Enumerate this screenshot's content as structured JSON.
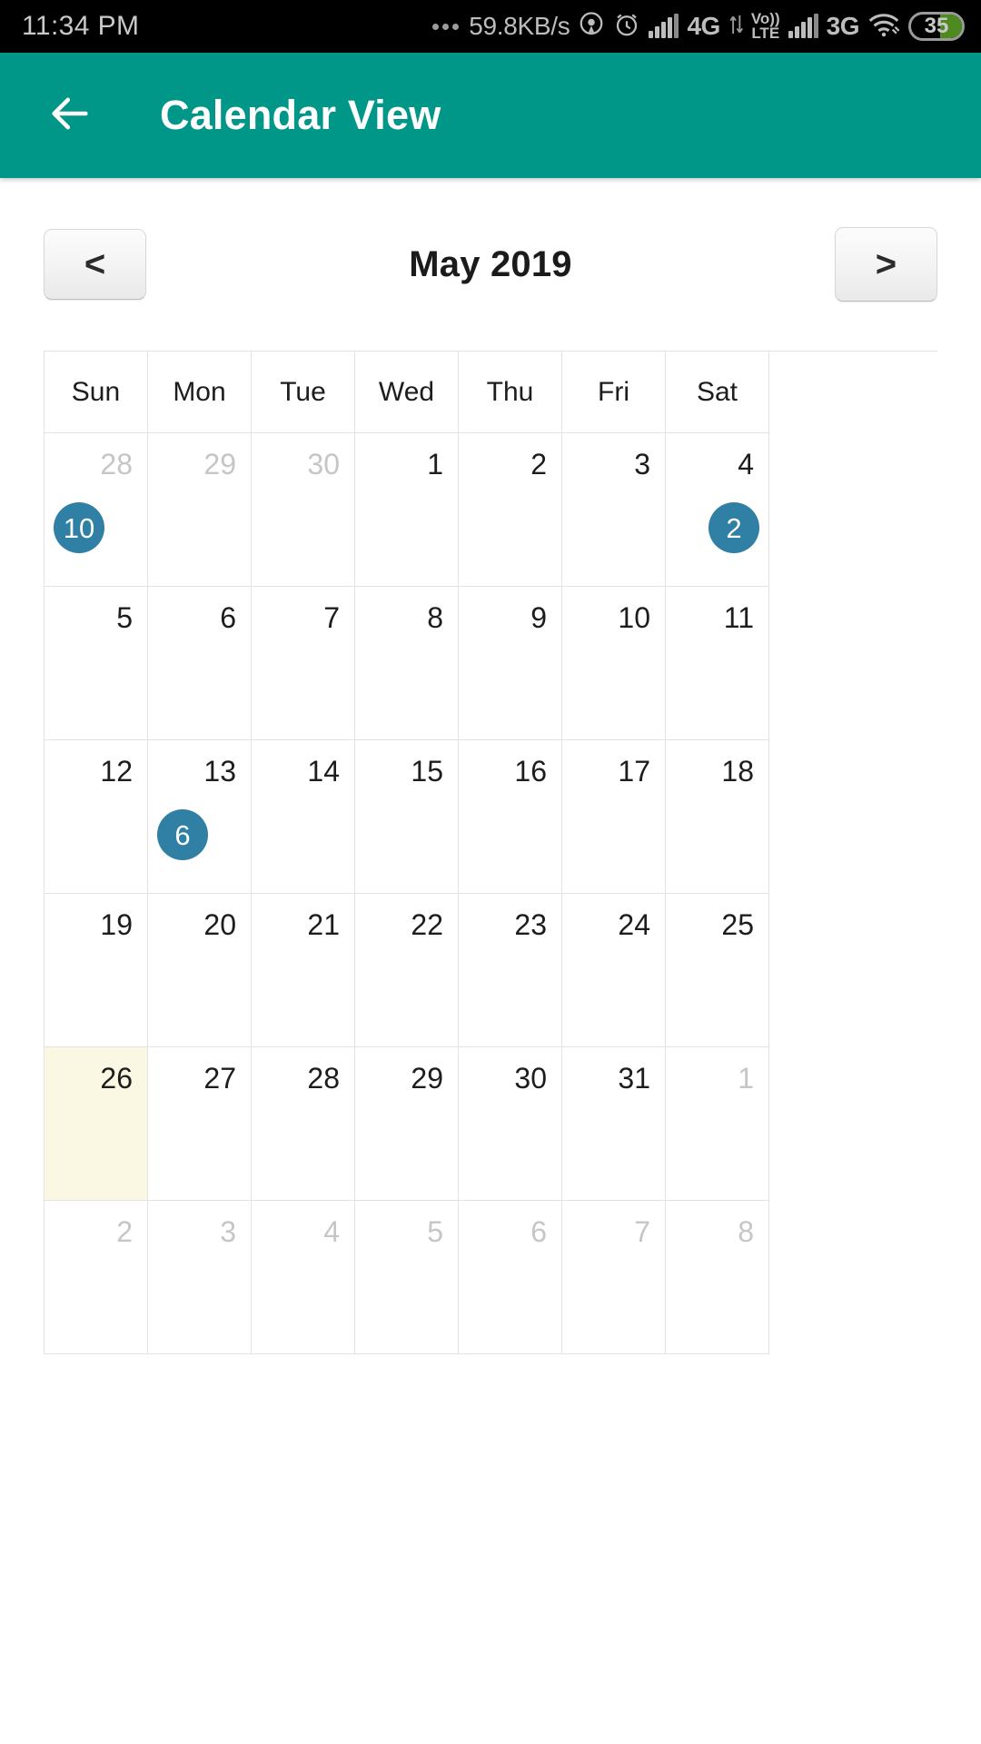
{
  "status_bar": {
    "time": "11:34 PM",
    "network_speed": "59.8KB/s",
    "network_1": "4G",
    "volte_top": "Vo))",
    "volte_bottom": "LTE",
    "network_2": "3G",
    "battery_level": "35",
    "icons": [
      "location-icon",
      "alarm-icon",
      "signal-bars-icon",
      "volte-icon",
      "wifi-icon",
      "battery-icon"
    ]
  },
  "app_bar": {
    "back_icon": "arrow-left-icon",
    "title": "Calendar View",
    "color": "#009688"
  },
  "month_nav": {
    "prev_label": "<",
    "next_label": ">",
    "month_title": "May 2019"
  },
  "calendar": {
    "weekday_headers": [
      "Sun",
      "Mon",
      "Tue",
      "Wed",
      "Thu",
      "Fri",
      "Sat"
    ],
    "today_color": "#faf7e2",
    "badge_color": "#2f80a4",
    "weeks": [
      [
        {
          "day": "28",
          "muted": true,
          "today": false,
          "badge": "10",
          "badge_side": "left"
        },
        {
          "day": "29",
          "muted": true,
          "today": false,
          "badge": null,
          "badge_side": null
        },
        {
          "day": "30",
          "muted": true,
          "today": false,
          "badge": null,
          "badge_side": null
        },
        {
          "day": "1",
          "muted": false,
          "today": false,
          "badge": null,
          "badge_side": null
        },
        {
          "day": "2",
          "muted": false,
          "today": false,
          "badge": null,
          "badge_side": null
        },
        {
          "day": "3",
          "muted": false,
          "today": false,
          "badge": null,
          "badge_side": null
        },
        {
          "day": "4",
          "muted": false,
          "today": false,
          "badge": "2",
          "badge_side": "right"
        }
      ],
      [
        {
          "day": "5",
          "muted": false,
          "today": false,
          "badge": null,
          "badge_side": null
        },
        {
          "day": "6",
          "muted": false,
          "today": false,
          "badge": null,
          "badge_side": null
        },
        {
          "day": "7",
          "muted": false,
          "today": false,
          "badge": null,
          "badge_side": null
        },
        {
          "day": "8",
          "muted": false,
          "today": false,
          "badge": null,
          "badge_side": null
        },
        {
          "day": "9",
          "muted": false,
          "today": false,
          "badge": null,
          "badge_side": null
        },
        {
          "day": "10",
          "muted": false,
          "today": false,
          "badge": null,
          "badge_side": null
        },
        {
          "day": "11",
          "muted": false,
          "today": false,
          "badge": null,
          "badge_side": null
        }
      ],
      [
        {
          "day": "12",
          "muted": false,
          "today": false,
          "badge": null,
          "badge_side": null
        },
        {
          "day": "13",
          "muted": false,
          "today": false,
          "badge": "6",
          "badge_side": "left"
        },
        {
          "day": "14",
          "muted": false,
          "today": false,
          "badge": null,
          "badge_side": null
        },
        {
          "day": "15",
          "muted": false,
          "today": false,
          "badge": null,
          "badge_side": null
        },
        {
          "day": "16",
          "muted": false,
          "today": false,
          "badge": null,
          "badge_side": null
        },
        {
          "day": "17",
          "muted": false,
          "today": false,
          "badge": null,
          "badge_side": null
        },
        {
          "day": "18",
          "muted": false,
          "today": false,
          "badge": null,
          "badge_side": null
        }
      ],
      [
        {
          "day": "19",
          "muted": false,
          "today": false,
          "badge": null,
          "badge_side": null
        },
        {
          "day": "20",
          "muted": false,
          "today": false,
          "badge": null,
          "badge_side": null
        },
        {
          "day": "21",
          "muted": false,
          "today": false,
          "badge": null,
          "badge_side": null
        },
        {
          "day": "22",
          "muted": false,
          "today": false,
          "badge": null,
          "badge_side": null
        },
        {
          "day": "23",
          "muted": false,
          "today": false,
          "badge": null,
          "badge_side": null
        },
        {
          "day": "24",
          "muted": false,
          "today": false,
          "badge": null,
          "badge_side": null
        },
        {
          "day": "25",
          "muted": false,
          "today": false,
          "badge": null,
          "badge_side": null
        }
      ],
      [
        {
          "day": "26",
          "muted": false,
          "today": true,
          "badge": null,
          "badge_side": null
        },
        {
          "day": "27",
          "muted": false,
          "today": false,
          "badge": null,
          "badge_side": null
        },
        {
          "day": "28",
          "muted": false,
          "today": false,
          "badge": null,
          "badge_side": null
        },
        {
          "day": "29",
          "muted": false,
          "today": false,
          "badge": null,
          "badge_side": null
        },
        {
          "day": "30",
          "muted": false,
          "today": false,
          "badge": null,
          "badge_side": null
        },
        {
          "day": "31",
          "muted": false,
          "today": false,
          "badge": null,
          "badge_side": null
        },
        {
          "day": "1",
          "muted": true,
          "today": false,
          "badge": null,
          "badge_side": null
        }
      ],
      [
        {
          "day": "2",
          "muted": true,
          "today": false,
          "badge": null,
          "badge_side": null
        },
        {
          "day": "3",
          "muted": true,
          "today": false,
          "badge": null,
          "badge_side": null
        },
        {
          "day": "4",
          "muted": true,
          "today": false,
          "badge": null,
          "badge_side": null
        },
        {
          "day": "5",
          "muted": true,
          "today": false,
          "badge": null,
          "badge_side": null
        },
        {
          "day": "6",
          "muted": true,
          "today": false,
          "badge": null,
          "badge_side": null
        },
        {
          "day": "7",
          "muted": true,
          "today": false,
          "badge": null,
          "badge_side": null
        },
        {
          "day": "8",
          "muted": true,
          "today": false,
          "badge": null,
          "badge_side": null
        }
      ]
    ]
  }
}
